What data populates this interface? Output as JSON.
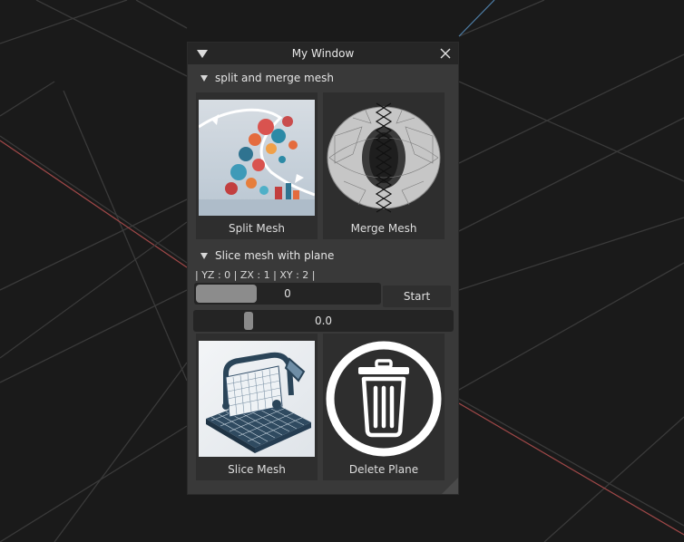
{
  "window": {
    "title": "My Window"
  },
  "sections": [
    {
      "label": "split and merge mesh",
      "tiles": [
        {
          "label": "Split Mesh",
          "icon": "split-mesh-image"
        },
        {
          "label": "Merge Mesh",
          "icon": "merge-mesh-image"
        }
      ]
    },
    {
      "label": "Slice mesh with plane",
      "axes_label": "| YZ : 0 | ZX : 1 | XY : 2 |",
      "axis_slider": {
        "value": "0",
        "fraction": 0.0
      },
      "start_label": "Start",
      "offset_slider": {
        "value": "0.0",
        "fraction": 0.2
      },
      "tiles": [
        {
          "label": "Slice Mesh",
          "icon": "slice-mesh-image"
        },
        {
          "label": "Delete Plane",
          "icon": "trash-icon"
        }
      ]
    }
  ],
  "colors": {
    "window_bg": "#393939",
    "titlebar_bg": "#262626",
    "viewport_bg": "#1a1a1a",
    "grid_line": "#3a3a3a",
    "axis_red": "#a04848",
    "axis_blue": "#4f7fa8"
  }
}
